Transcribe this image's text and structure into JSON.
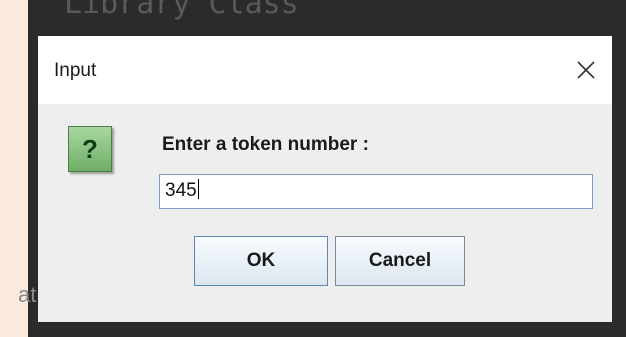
{
  "background": {
    "top_text": "Library Class",
    "left_text": "at"
  },
  "dialog": {
    "title": "Input",
    "close_icon": "close-icon",
    "question_icon": "?",
    "prompt": "Enter a token number :",
    "input_value": "345",
    "ok_label": "OK",
    "cancel_label": "Cancel"
  },
  "colors": {
    "page_background": "#fbe9dc",
    "dark_background": "#2b2b2b",
    "dialog_body": "#eeeeee",
    "titlebar": "#ffffff",
    "input_border": "#7a9cc6",
    "question_icon_fill": "#8cc383"
  }
}
